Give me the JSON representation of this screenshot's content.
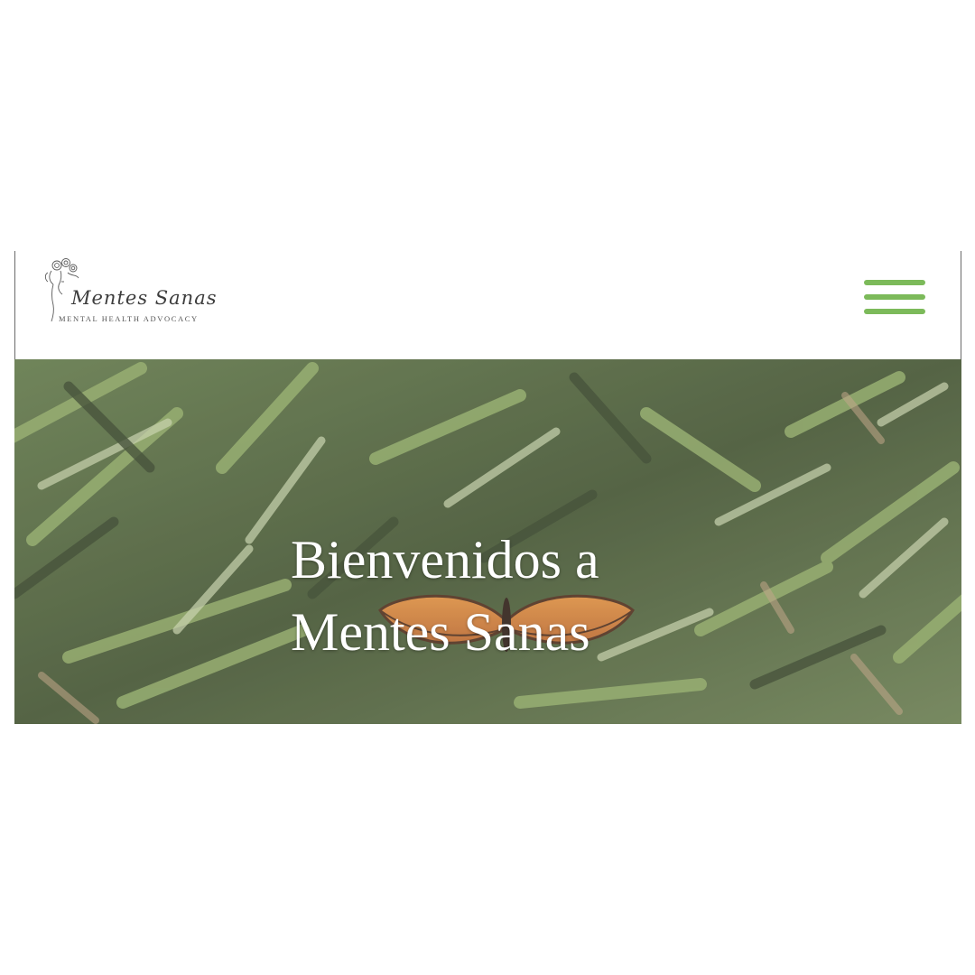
{
  "header": {
    "logo": {
      "name": "Mentes Sanas",
      "tagline": "MENTAL HEALTH ADVOCACY",
      "icon": "woman-face-flowers-icon"
    },
    "menu": {
      "icon": "hamburger-menu-icon",
      "color": "#7cba5a"
    }
  },
  "hero": {
    "title_line1": "Bienvenidos a",
    "title_line2": "Mentes Sanas",
    "background": "grass-with-monarch-butterfly-photo"
  }
}
